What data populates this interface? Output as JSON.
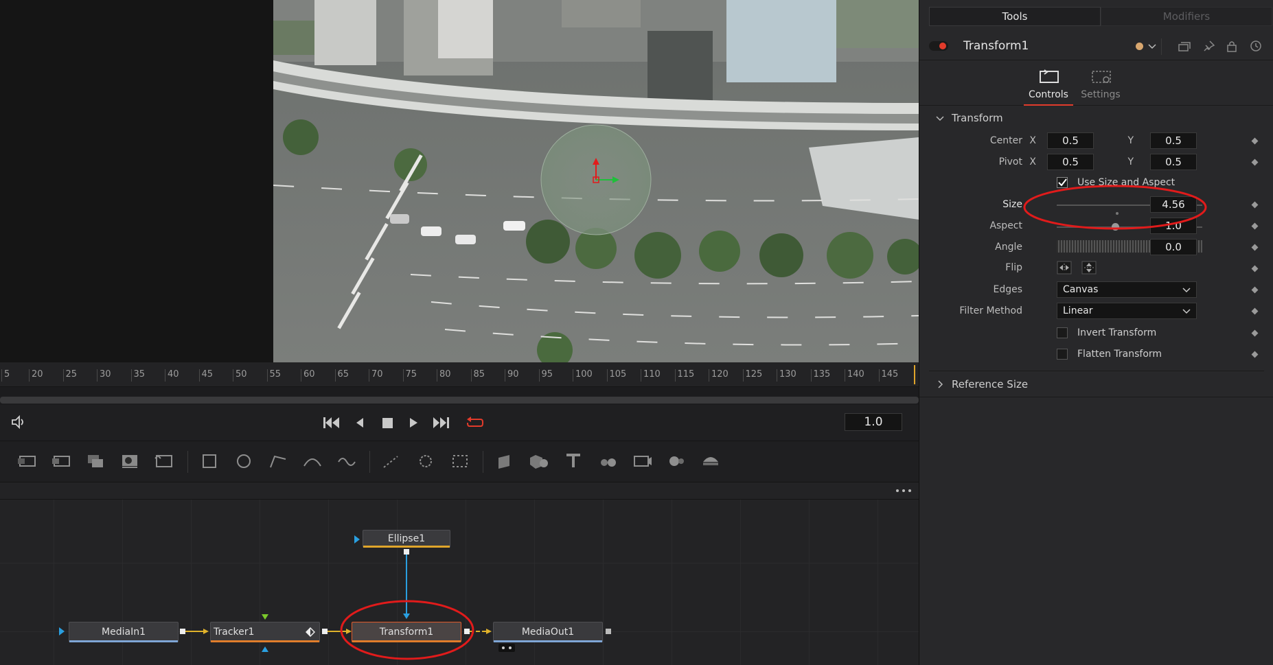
{
  "inspector": {
    "tabs": [
      {
        "label": "Tools",
        "active": true
      },
      {
        "label": "Modifiers",
        "active": false
      }
    ],
    "node_name": "Transform1",
    "subtabs": [
      {
        "label": "Controls",
        "active": true
      },
      {
        "label": "Settings",
        "active": false
      }
    ],
    "section_transform": "Transform",
    "center": {
      "label": "Center",
      "x_label": "X",
      "x": "0.5",
      "y_label": "Y",
      "y": "0.5"
    },
    "pivot": {
      "label": "Pivot",
      "x_label": "X",
      "x": "0.5",
      "y_label": "Y",
      "y": "0.5"
    },
    "use_size_aspect": {
      "label": "Use Size and Aspect",
      "checked": true
    },
    "size": {
      "label": "Size",
      "value": "4.56",
      "level": 0.91
    },
    "aspect": {
      "label": "Aspect",
      "value": "1.0",
      "level": 0.5
    },
    "angle": {
      "label": "Angle",
      "value": "0.0"
    },
    "flip": {
      "label": "Flip"
    },
    "edges": {
      "label": "Edges",
      "value": "Canvas"
    },
    "filter_method": {
      "label": "Filter Method",
      "value": "Linear"
    },
    "invert_transform": {
      "label": "Invert Transform",
      "checked": false
    },
    "flatten_transform": {
      "label": "Flatten Transform",
      "checked": false
    },
    "section_reference": "Reference Size",
    "highlight_color": "#e11b1b",
    "node_color_dot": "#d8a66e"
  },
  "timeline": {
    "ticks": [
      "5",
      "20",
      "25",
      "30",
      "35",
      "40",
      "45",
      "50",
      "55",
      "60",
      "65",
      "70",
      "75",
      "80",
      "85",
      "90",
      "95",
      "100",
      "105",
      "110",
      "115",
      "120",
      "125",
      "130",
      "135",
      "140",
      "145"
    ],
    "speed": "1.0"
  },
  "flow": {
    "nodes": [
      {
        "name": "MediaIn1",
        "line_color": "#7fa6d6"
      },
      {
        "name": "Tracker1",
        "line_color": "#e07d2b"
      },
      {
        "name": "Transform1",
        "line_color": "#e07d2b"
      },
      {
        "name": "MediaOut1",
        "line_color": "#7fa6d6"
      },
      {
        "name": "Ellipse1",
        "line_color": "#e0a52b"
      }
    ]
  }
}
